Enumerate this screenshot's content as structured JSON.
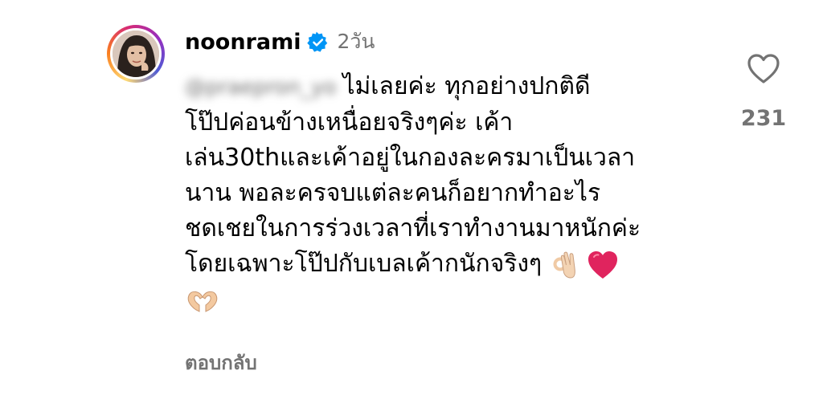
{
  "comment": {
    "username": "noonrami",
    "verified": true,
    "time": "2วัน",
    "mention": "@praepron_yo",
    "lines": [
      "ไม่เลยค่ะ ทุกอย่างปกติดี",
      "โป๊ปค่อนข้างเหนื่อยจริงๆค่ะ เค้า",
      "เล่น30thและเค้าอยู่ในกองละครมาเป็นเวลา",
      "นาน พอละครจบแต่ละคนก็อยากทำอะไร",
      "ชดเชยในการร่วงเวลาที่เราทำงานมาหนักค่ะ",
      "โดยเฉพาะโป๊ปกับเบลเค้ากนักจริงๆ"
    ],
    "emojis": [
      "ok-hand-emoji",
      "red-heart-emoji",
      "heart-hands-emoji"
    ],
    "like_count": "231",
    "reply_label": "ตอบกลับ"
  },
  "colors": {
    "secondary_text": "#737373",
    "verified_blue": "#0095f6",
    "heart_red": "#e0245e"
  }
}
